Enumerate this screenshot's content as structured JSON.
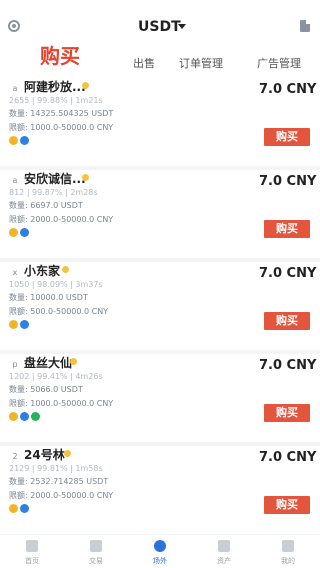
{
  "header": {
    "currency": "USDT",
    "buy_tab": "购买",
    "sell_tab": "出售",
    "orders_tab": "订单管理",
    "ads_tab": "广告管理"
  },
  "listings": [
    {
      "avatar": "a",
      "name": "阿建秒放...",
      "stats": "2655 | 99.88% | 1m21s",
      "quantity": "数量: 14325.504325 USDT",
      "limit": "限额: 1000.0-50000.0 CNY",
      "payments": [
        "yellow-pay-icon",
        "blue-pay-icon"
      ],
      "price": "7.0 CNY",
      "buy_label": "购买"
    },
    {
      "avatar": "a",
      "name": "安欣诚信...",
      "stats": "812 | 99.87% | 2m28s",
      "quantity": "数量: 6697.0 USDT",
      "limit": "限额: 2000.0-50000.0 CNY",
      "payments": [
        "yellow-pay-icon",
        "blue-pay-icon"
      ],
      "price": "7.0 CNY",
      "buy_label": "购买"
    },
    {
      "avatar": "x",
      "name": "小东家",
      "stats": "1050 | 98.09% | 3m37s",
      "quantity": "数量: 10000.0 USDT",
      "limit": "限额: 500.0-50000.0 CNY",
      "payments": [
        "yellow-pay-icon",
        "blue-pay-icon"
      ],
      "price": "7.0 CNY",
      "buy_label": "购买"
    },
    {
      "avatar": "p",
      "name": "盘丝大仙",
      "stats": "1202 | 99.41% | 4m26s",
      "quantity": "数量: 5066.0 USDT",
      "limit": "限额: 1000.0-50000.0 CNY",
      "payments": [
        "yellow-pay-icon",
        "blue-pay-icon",
        "green-pay-icon"
      ],
      "price": "7.0 CNY",
      "buy_label": "购买"
    },
    {
      "avatar": "2",
      "name": "24号林",
      "stats": "2129 | 99.81% | 1m58s",
      "quantity": "数量: 2532.714285 USDT",
      "limit": "限额: 2000.0-50000.0 CNY",
      "payments": [
        "yellow-pay-icon",
        "blue-pay-icon"
      ],
      "price": "7.0 CNY",
      "buy_label": "购买"
    }
  ],
  "tabbar": {
    "items": [
      {
        "label": "首页",
        "icon": "home-icon"
      },
      {
        "label": "交易",
        "icon": "trade-icon"
      },
      {
        "label": "场外",
        "icon": "otc-icon"
      },
      {
        "label": "资产",
        "icon": "assets-icon"
      },
      {
        "label": "我的",
        "icon": "profile-icon"
      }
    ],
    "active_index": 2
  },
  "colors": {
    "accent_red": "#e4553e",
    "active_blue": "#2b73d9",
    "verified_gold": "#f5c242"
  }
}
